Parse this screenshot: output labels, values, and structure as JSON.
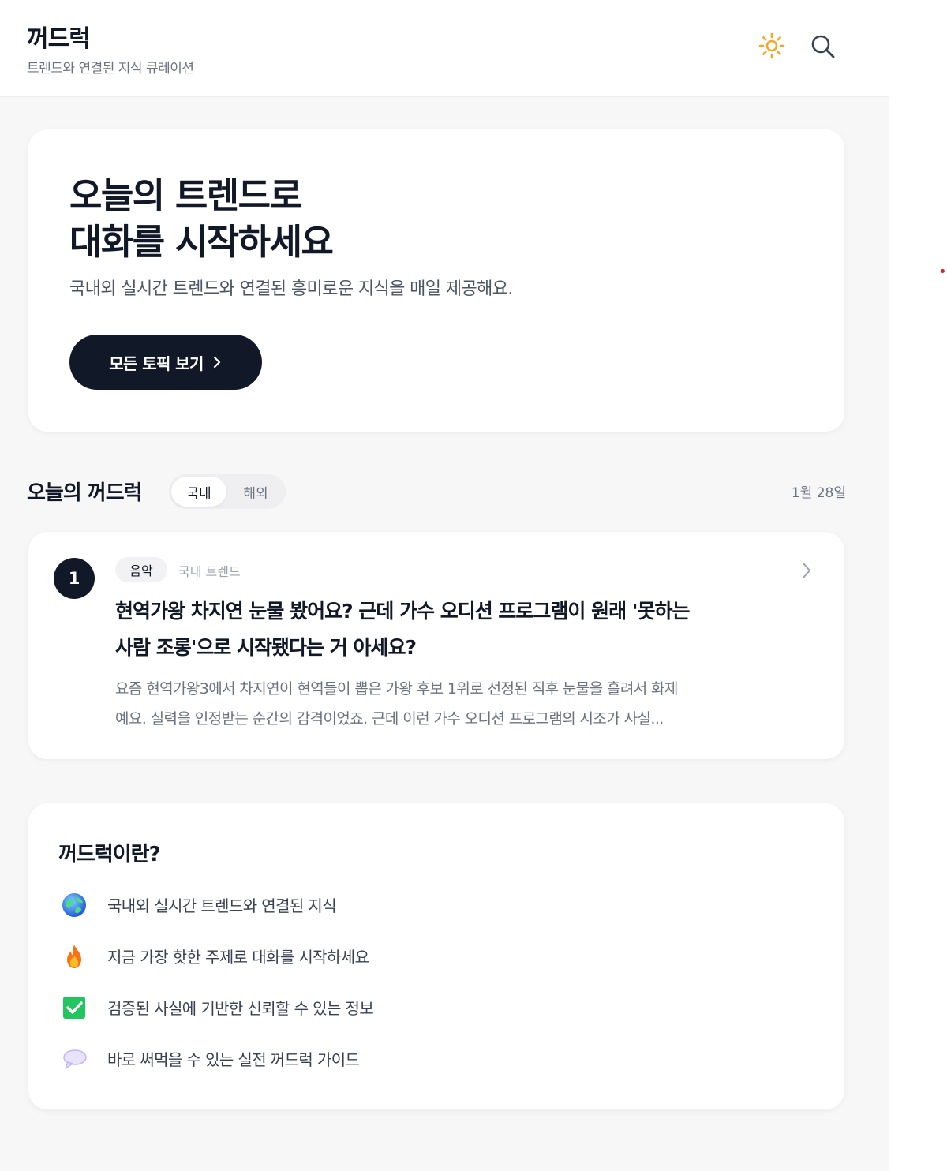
{
  "header": {
    "logo": "꺼드럭",
    "tagline": "트렌드와 연결된 지식 큐레이션",
    "theme_icon": "sun-icon",
    "search_icon": "search-icon"
  },
  "hero": {
    "title_line1": "오늘의 트렌드로",
    "title_line2": "대화를 시작하세요",
    "description": "국내외 실시간 트렌드와 연결된 흥미로운 지식을 매일 제공해요.",
    "button_label": "모든 토픽 보기"
  },
  "today": {
    "section_title": "오늘의 꺼드럭",
    "tabs": [
      {
        "label": "국내",
        "active": true
      },
      {
        "label": "해외",
        "active": false
      }
    ],
    "date": "1월 28일",
    "topics": [
      {
        "rank": "1",
        "category": "음악",
        "trend_type": "국내 트렌드",
        "title_line1": "현역가왕 차지연 눈물 봤어요? 근데 가수 오디션 프로그램이 원래 '못하는",
        "title_line2": "사람 조롱'으로 시작됐다는 거 아세요?",
        "summary_line1": "요즘 현역가왕3에서 차지연이 현역들이 뽑은 가왕 후보 1위로 선정된 직후 눈물을 흘려서 화제",
        "summary_line2": "예요. 실력을 인정받는 순간의 감격이었죠. 근데 이런 가수 오디션 프로그램의 시조가 사실..."
      }
    ]
  },
  "about": {
    "title": "꺼드럭이란?",
    "features": [
      {
        "icon": "globe-icon",
        "text": "국내외 실시간 트렌드와 연결된 지식"
      },
      {
        "icon": "fire-icon",
        "text": "지금 가장 핫한 주제로 대화를 시작하세요"
      },
      {
        "icon": "check-icon",
        "text": "검증된 사실에 기반한 신뢰할 수 있는 정보"
      },
      {
        "icon": "speech-bubble-icon",
        "text": "바로 써먹을 수 있는 실전 꺼드럭 가이드"
      }
    ]
  },
  "colors": {
    "accent_dark": "#111827",
    "sun": "#f5a623",
    "check_green": "#22c55e",
    "background": "#f7f7f8"
  }
}
